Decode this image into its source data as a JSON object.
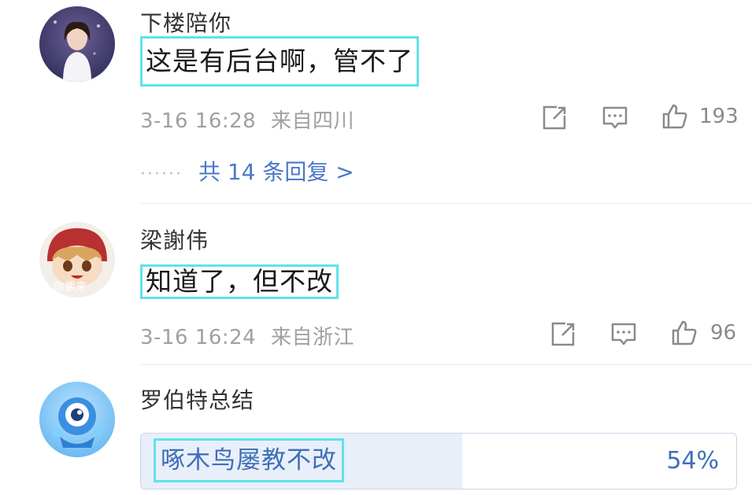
{
  "comments": [
    {
      "username": "下楼陪你",
      "content": "这是有后台啊，管不了",
      "timestamp": "3-16 16:28",
      "location": "来自四川",
      "like_count": "193",
      "replies_text": "共 14 条回复 >",
      "replies_dots": "······"
    },
    {
      "username": "梁謝伟",
      "content": "知道了，但不改",
      "timestamp": "3-16 16:24",
      "location": "来自浙江",
      "like_count": "96",
      "avatar_caption": "你爹来"
    },
    {
      "username": "罗伯特总结",
      "poll": {
        "option": "啄木鸟屡教不改",
        "percent_label": "54%",
        "percent_value": 54
      }
    }
  ],
  "colors": {
    "highlight_border": "#5fe3e8",
    "link_blue": "#4a78c8",
    "meta_gray": "#a0a0a0"
  },
  "icons": [
    "share-icon",
    "comment-icon",
    "like-icon"
  ]
}
